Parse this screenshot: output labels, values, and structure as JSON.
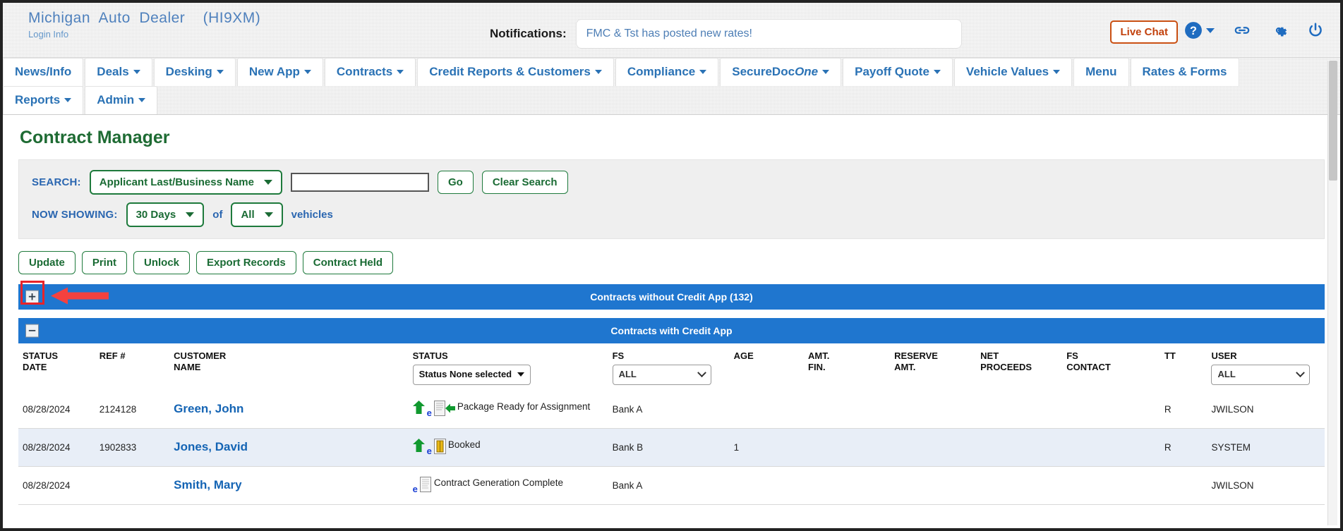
{
  "header": {
    "brand_title": "Michigan  Auto  Dealer    (HI9XM)",
    "brand_sub": "Login  Info",
    "notifications_label": "Notifications:",
    "notification_text": "FMC & Tst has posted new rates!",
    "live_chat_label": "Live Chat",
    "icons": [
      "help-icon",
      "link-icon",
      "gear-icon",
      "power-icon"
    ]
  },
  "nav": {
    "row1": [
      {
        "label": "News/Info",
        "caret": false
      },
      {
        "label": "Deals",
        "caret": true
      },
      {
        "label": "Desking",
        "caret": true
      },
      {
        "label": "New App",
        "caret": true
      },
      {
        "label": "Contracts",
        "caret": true
      },
      {
        "label": "Credit Reports & Customers",
        "caret": true
      },
      {
        "label": "Compliance",
        "caret": true
      },
      {
        "label": "SecureDocOne",
        "caret": true
      },
      {
        "label": "Payoff Quote",
        "caret": true
      },
      {
        "label": "Vehicle Values",
        "caret": true
      },
      {
        "label": "Menu",
        "caret": false
      },
      {
        "label": "Rates & Forms",
        "caret": false
      }
    ],
    "row2": [
      {
        "label": "Reports",
        "caret": true
      },
      {
        "label": "Admin",
        "caret": true
      }
    ]
  },
  "page": {
    "title": "Contract Manager"
  },
  "search": {
    "label": "SEARCH:",
    "criteria_value": "Applicant Last/Business Name",
    "input_value": "",
    "input_placeholder": "",
    "go_label": "Go",
    "clear_label": "Clear Search",
    "now_showing_label": "NOW SHOWING:",
    "days_value": "30 Days",
    "of_label": "of",
    "vehicles_value": "All",
    "vehicles_label": "vehicles"
  },
  "actions": [
    {
      "label": "Update"
    },
    {
      "label": "Print"
    },
    {
      "label": "Unlock"
    },
    {
      "label": "Export Records"
    },
    {
      "label": "Contract Held"
    }
  ],
  "sections": {
    "without_credit_app": {
      "title": "Contracts without Credit App (132)",
      "expander": "+",
      "highlighted": true
    },
    "with_credit_app": {
      "title": "Contracts with Credit App",
      "expander": "−",
      "highlighted": false
    }
  },
  "table": {
    "columns": [
      {
        "line1": "STATUS",
        "line2": "DATE"
      },
      {
        "line1": "REF #",
        "line2": ""
      },
      {
        "line1": "CUSTOMER",
        "line2": "NAME"
      },
      {
        "line1": "STATUS",
        "line2": "",
        "control": "Status None selected"
      },
      {
        "line1": "FS",
        "line2": "",
        "control": "ALL"
      },
      {
        "line1": "AGE",
        "line2": ""
      },
      {
        "line1": "AMT.",
        "line2": "FIN."
      },
      {
        "line1": "RESERVE",
        "line2": "AMT."
      },
      {
        "line1": "NET",
        "line2": "PROCEEDS"
      },
      {
        "line1": "FS",
        "line2": "CONTACT"
      },
      {
        "line1": "TT",
        "line2": ""
      },
      {
        "line1": "USER",
        "line2": "",
        "control": "ALL"
      }
    ],
    "rows": [
      {
        "status_date": "08/28/2024",
        "ref": "2124128",
        "customer": "Green, John",
        "status_text": "Package Ready for Assignment",
        "icons": [
          "up-arrow-icon",
          "e-icon",
          "document-arrow-icon"
        ],
        "fs": "Bank A",
        "age": "",
        "amt_fin": "",
        "reserve_amt": "",
        "net_proceeds": "",
        "fs_contact": "",
        "tt": "R",
        "user": "JWILSON"
      },
      {
        "status_date": "08/28/2024",
        "ref": "1902833",
        "customer": "Jones, David",
        "status_text": "Booked",
        "icons": [
          "up-arrow-icon",
          "e-icon",
          "money-icon"
        ],
        "fs": "Bank B",
        "age": "1",
        "amt_fin": "",
        "reserve_amt": "",
        "net_proceeds": "",
        "fs_contact": "",
        "tt": "R",
        "user": "SYSTEM"
      },
      {
        "status_date": "08/28/2024",
        "ref": "",
        "customer": "Smith, Mary",
        "status_text": "Contract Generation Complete",
        "icons": [
          "e-icon",
          "document-icon"
        ],
        "fs": "Bank A",
        "age": "",
        "amt_fin": "",
        "reserve_amt": "",
        "net_proceeds": "",
        "fs_contact": "",
        "tt": "",
        "user": "JWILSON"
      }
    ]
  },
  "colors": {
    "section_blue": "#1f76cf",
    "brand_blue": "#4f81bd",
    "nav_blue": "#2a72b5",
    "green": "#1e7a3c",
    "title_green": "#1e6b33",
    "annotation_red": "#e8232a",
    "live_chat_orange": "#c2410c"
  }
}
